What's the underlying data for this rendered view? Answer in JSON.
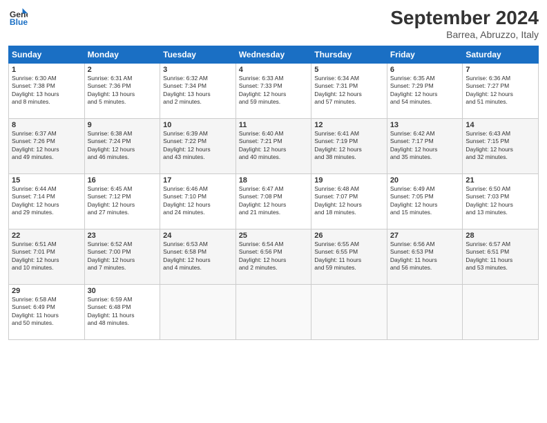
{
  "header": {
    "logo_line1": "General",
    "logo_line2": "Blue",
    "month_title": "September 2024",
    "location": "Barrea, Abruzzo, Italy"
  },
  "days_of_week": [
    "Sunday",
    "Monday",
    "Tuesday",
    "Wednesday",
    "Thursday",
    "Friday",
    "Saturday"
  ],
  "weeks": [
    [
      {
        "num": "1",
        "info": "Sunrise: 6:30 AM\nSunset: 7:38 PM\nDaylight: 13 hours\nand 8 minutes."
      },
      {
        "num": "2",
        "info": "Sunrise: 6:31 AM\nSunset: 7:36 PM\nDaylight: 13 hours\nand 5 minutes."
      },
      {
        "num": "3",
        "info": "Sunrise: 6:32 AM\nSunset: 7:34 PM\nDaylight: 13 hours\nand 2 minutes."
      },
      {
        "num": "4",
        "info": "Sunrise: 6:33 AM\nSunset: 7:33 PM\nDaylight: 12 hours\nand 59 minutes."
      },
      {
        "num": "5",
        "info": "Sunrise: 6:34 AM\nSunset: 7:31 PM\nDaylight: 12 hours\nand 57 minutes."
      },
      {
        "num": "6",
        "info": "Sunrise: 6:35 AM\nSunset: 7:29 PM\nDaylight: 12 hours\nand 54 minutes."
      },
      {
        "num": "7",
        "info": "Sunrise: 6:36 AM\nSunset: 7:27 PM\nDaylight: 12 hours\nand 51 minutes."
      }
    ],
    [
      {
        "num": "8",
        "info": "Sunrise: 6:37 AM\nSunset: 7:26 PM\nDaylight: 12 hours\nand 49 minutes."
      },
      {
        "num": "9",
        "info": "Sunrise: 6:38 AM\nSunset: 7:24 PM\nDaylight: 12 hours\nand 46 minutes."
      },
      {
        "num": "10",
        "info": "Sunrise: 6:39 AM\nSunset: 7:22 PM\nDaylight: 12 hours\nand 43 minutes."
      },
      {
        "num": "11",
        "info": "Sunrise: 6:40 AM\nSunset: 7:21 PM\nDaylight: 12 hours\nand 40 minutes."
      },
      {
        "num": "12",
        "info": "Sunrise: 6:41 AM\nSunset: 7:19 PM\nDaylight: 12 hours\nand 38 minutes."
      },
      {
        "num": "13",
        "info": "Sunrise: 6:42 AM\nSunset: 7:17 PM\nDaylight: 12 hours\nand 35 minutes."
      },
      {
        "num": "14",
        "info": "Sunrise: 6:43 AM\nSunset: 7:15 PM\nDaylight: 12 hours\nand 32 minutes."
      }
    ],
    [
      {
        "num": "15",
        "info": "Sunrise: 6:44 AM\nSunset: 7:14 PM\nDaylight: 12 hours\nand 29 minutes."
      },
      {
        "num": "16",
        "info": "Sunrise: 6:45 AM\nSunset: 7:12 PM\nDaylight: 12 hours\nand 27 minutes."
      },
      {
        "num": "17",
        "info": "Sunrise: 6:46 AM\nSunset: 7:10 PM\nDaylight: 12 hours\nand 24 minutes."
      },
      {
        "num": "18",
        "info": "Sunrise: 6:47 AM\nSunset: 7:08 PM\nDaylight: 12 hours\nand 21 minutes."
      },
      {
        "num": "19",
        "info": "Sunrise: 6:48 AM\nSunset: 7:07 PM\nDaylight: 12 hours\nand 18 minutes."
      },
      {
        "num": "20",
        "info": "Sunrise: 6:49 AM\nSunset: 7:05 PM\nDaylight: 12 hours\nand 15 minutes."
      },
      {
        "num": "21",
        "info": "Sunrise: 6:50 AM\nSunset: 7:03 PM\nDaylight: 12 hours\nand 13 minutes."
      }
    ],
    [
      {
        "num": "22",
        "info": "Sunrise: 6:51 AM\nSunset: 7:01 PM\nDaylight: 12 hours\nand 10 minutes."
      },
      {
        "num": "23",
        "info": "Sunrise: 6:52 AM\nSunset: 7:00 PM\nDaylight: 12 hours\nand 7 minutes."
      },
      {
        "num": "24",
        "info": "Sunrise: 6:53 AM\nSunset: 6:58 PM\nDaylight: 12 hours\nand 4 minutes."
      },
      {
        "num": "25",
        "info": "Sunrise: 6:54 AM\nSunset: 6:56 PM\nDaylight: 12 hours\nand 2 minutes."
      },
      {
        "num": "26",
        "info": "Sunrise: 6:55 AM\nSunset: 6:55 PM\nDaylight: 11 hours\nand 59 minutes."
      },
      {
        "num": "27",
        "info": "Sunrise: 6:56 AM\nSunset: 6:53 PM\nDaylight: 11 hours\nand 56 minutes."
      },
      {
        "num": "28",
        "info": "Sunrise: 6:57 AM\nSunset: 6:51 PM\nDaylight: 11 hours\nand 53 minutes."
      }
    ],
    [
      {
        "num": "29",
        "info": "Sunrise: 6:58 AM\nSunset: 6:49 PM\nDaylight: 11 hours\nand 50 minutes."
      },
      {
        "num": "30",
        "info": "Sunrise: 6:59 AM\nSunset: 6:48 PM\nDaylight: 11 hours\nand 48 minutes."
      },
      {
        "num": "",
        "info": ""
      },
      {
        "num": "",
        "info": ""
      },
      {
        "num": "",
        "info": ""
      },
      {
        "num": "",
        "info": ""
      },
      {
        "num": "",
        "info": ""
      }
    ]
  ]
}
